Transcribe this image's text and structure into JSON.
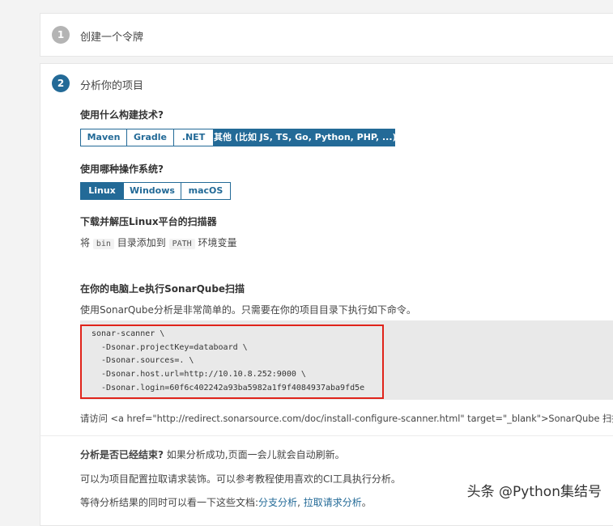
{
  "step1": {
    "number": "1",
    "title": "创建一个令牌"
  },
  "step2": {
    "number": "2",
    "title": "分析你的项目"
  },
  "build_question": "使用什么构建技术?",
  "build_options": [
    "Maven",
    "Gradle",
    ".NET",
    "其他 (比如 JS, TS, Go, Python, PHP, ...)"
  ],
  "build_selected": "其他 (比如 JS, TS, Go, Python, PHP, ...)",
  "os_question": "使用哪种操作系统?",
  "os_options": [
    "Linux",
    "Windows",
    "macOS"
  ],
  "os_selected": "Linux",
  "download_heading": "下载并解压Linux平台的扫描器",
  "path_text": {
    "prefix": "将",
    "bin": "bin",
    "middle": "目录添加到",
    "path": "PATH",
    "suffix": "环境变量"
  },
  "run_heading": "在你的电脑上e执行SonarQube扫描",
  "run_desc": "使用SonarQube分析是非常简单的。只需要在你的项目目录下执行如下命令。",
  "command_lines": [
    "sonar-scanner \\",
    "  -Dsonar.projectKey=databoard \\",
    "  -Dsonar.sources=. \\",
    "  -Dsonar.host.url=http://10.10.8.252:9000 \\",
    "  -Dsonar.login=60f6c402242a93ba5982a1f9f4084937aba9fd5e"
  ],
  "doc_link_text": "请访问 <a href=\"http://redirect.sonarsource.com/doc/install-configure-scanner.html\" target=\"_blank\">SonarQube 扫描器官方",
  "finished": {
    "question": "分析是否已经结束?",
    "answer": "如果分析成功,页面一会儿就会自动刷新。"
  },
  "decorate_text": "可以为项目配置拉取请求装饰。可以参考教程使用喜欢的CI工具执行分析。",
  "docs_text": {
    "prefix": "等待分析结果的同时可以看一下这些文档:",
    "link1": "分支分析",
    "sep": ", ",
    "link2": "拉取请求分析",
    "suffix": "。"
  },
  "watermark": "头条 @Python集结号",
  "colors": {
    "accent": "#236a97",
    "highlight_box": "#e0231a",
    "step_inactive": "#b4b4b4"
  }
}
